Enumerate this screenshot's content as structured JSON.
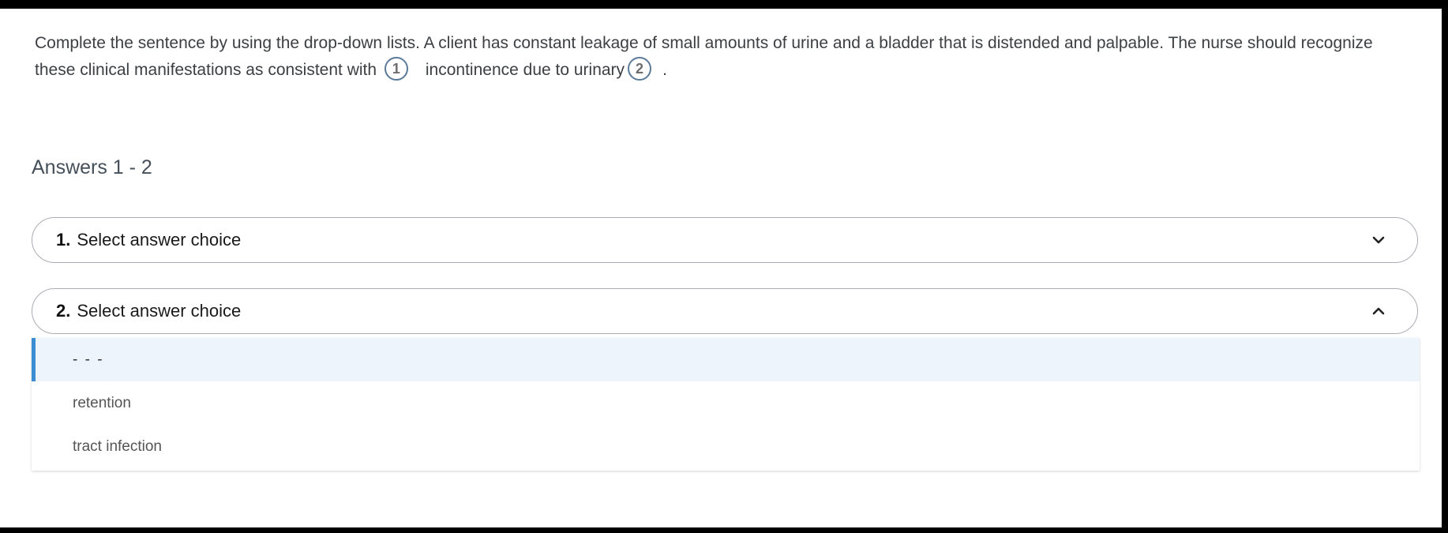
{
  "question": {
    "text_part1": "Complete the sentence by using the drop-down lists. A client has constant leakage of small amounts of urine and a bladder that is distended and palpable. The nurse should recognize these clinical manifestations as consistent with",
    "blank1": "1",
    "text_part2": "incontinence due to urinary",
    "blank2": "2",
    "text_part3": "."
  },
  "answers": {
    "title": "Answers 1 - 2",
    "dropdowns": [
      {
        "number": "1.",
        "label": "Select answer choice",
        "icon": "chevron-down-icon"
      },
      {
        "number": "2.",
        "label": "Select answer choice",
        "icon": "chevron-up-icon"
      }
    ],
    "options": [
      "- - -",
      "retention",
      "tract infection"
    ]
  },
  "colors": {
    "accent": "#3a8dd0",
    "highlight_bg": "#eef4fb",
    "blank_border": "#5b7a99"
  }
}
